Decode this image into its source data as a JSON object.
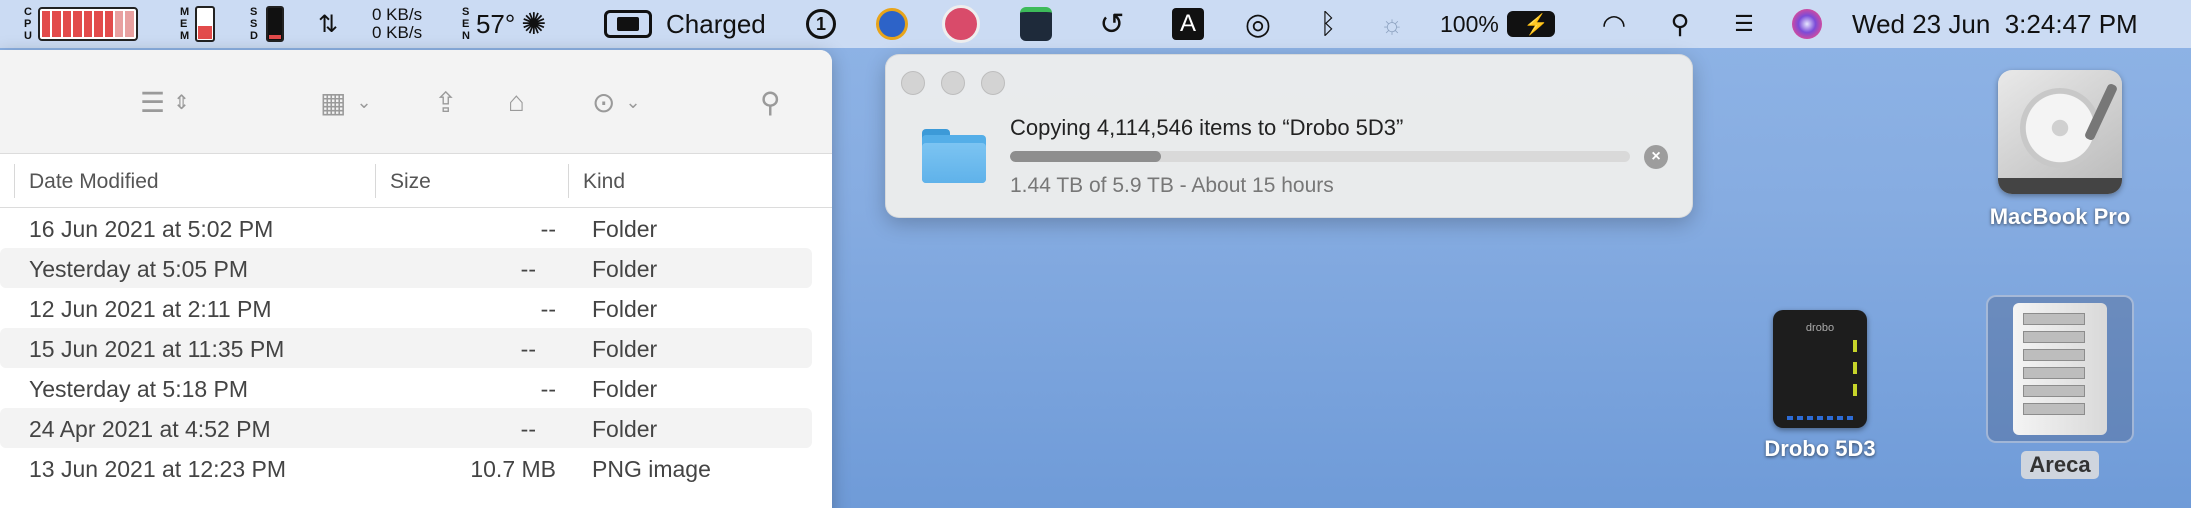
{
  "menubar": {
    "cpu_label": [
      "C",
      "P",
      "U"
    ],
    "mem_label": [
      "M",
      "E",
      "M"
    ],
    "ssd_label": [
      "S",
      "S",
      "D"
    ],
    "sen_label": [
      "S",
      "E",
      "N"
    ],
    "net_up": "0 KB/s",
    "net_down": "0 KB/s",
    "temperature": "57°",
    "battery_status": "Charged",
    "icon_a_letter": "A",
    "battery_percent": "100%",
    "datetime": "Wed 23 Jun  3:24:47 PM"
  },
  "finder": {
    "columns": {
      "date_modified": "Date Modified",
      "size": "Size",
      "kind": "Kind"
    },
    "rows": [
      {
        "date": "16 Jun 2021 at 5:02 PM",
        "size": "--",
        "kind": "Folder"
      },
      {
        "date": "Yesterday at 5:05 PM",
        "size": "--",
        "kind": "Folder"
      },
      {
        "date": "12 Jun 2021 at 2:11 PM",
        "size": "--",
        "kind": "Folder"
      },
      {
        "date": "15 Jun 2021 at 11:35 PM",
        "size": "--",
        "kind": "Folder"
      },
      {
        "date": "Yesterday at 5:18 PM",
        "size": "--",
        "kind": "Folder"
      },
      {
        "date": "24 Apr 2021 at 4:52 PM",
        "size": "--",
        "kind": "Folder"
      },
      {
        "date": "13 Jun 2021 at 12:23 PM",
        "size": "10.7 MB",
        "kind": "PNG image"
      }
    ]
  },
  "copy_dialog": {
    "title": "Copying 4,114,546 items to “Drobo 5D3”",
    "status": "1.44 TB of 5.9 TB - About 15 hours",
    "progress_fraction": 0.244
  },
  "desktop": {
    "macbook": "MacBook Pro",
    "drobo": "Drobo 5D3",
    "drobo_brand": "drobo",
    "areca": "Areca"
  },
  "colors": {
    "desktop": "#86ace1",
    "accent": "#54aee8",
    "cpu_red": "#e24b4b"
  }
}
